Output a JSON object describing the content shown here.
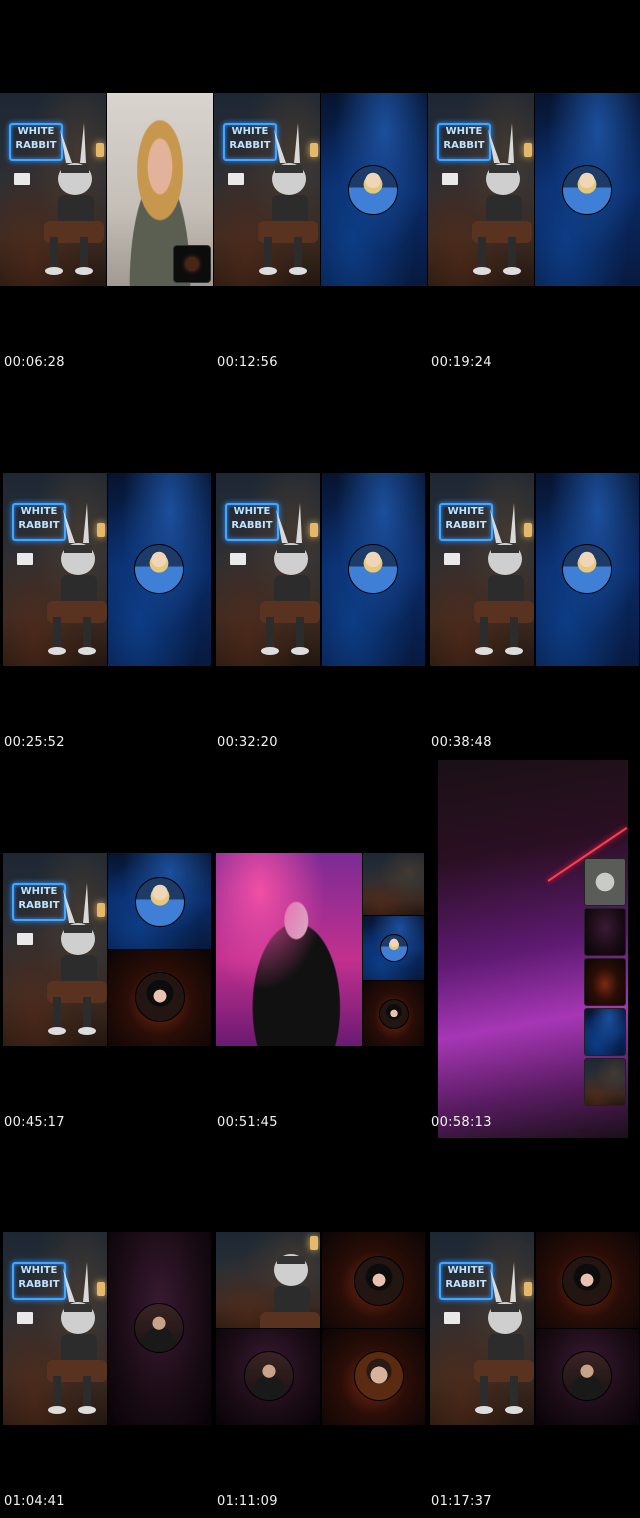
{
  "timestamps": [
    "00:06:28",
    "00:12:56",
    "00:19:24",
    "00:25:52",
    "00:32:20",
    "00:38:48",
    "00:45:17",
    "00:51:45",
    "00:58:13",
    "01:04:41",
    "01:11:09",
    "01:17:37"
  ],
  "neon_sign": {
    "line1": "WHITE",
    "line2": "RABBIT"
  },
  "colors": {
    "background": "#000000",
    "neon": "#3fa7ff",
    "timestamp_text": "#f2f2f2"
  }
}
